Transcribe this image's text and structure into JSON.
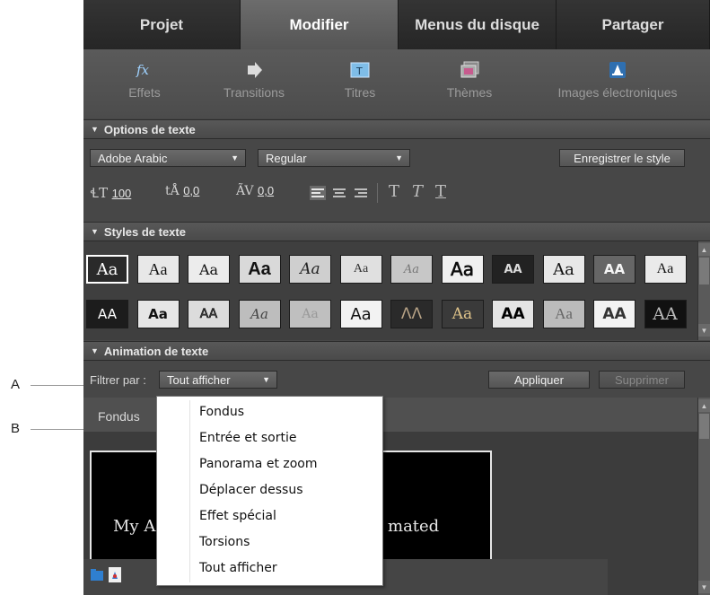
{
  "callouts": {
    "a": "A",
    "b": "B"
  },
  "tabs": [
    {
      "label": "Projet",
      "active": false
    },
    {
      "label": "Modifier",
      "active": true
    },
    {
      "label": "Menus du disque",
      "active": false
    },
    {
      "label": "Partager",
      "active": false
    }
  ],
  "toolbar": {
    "items": [
      {
        "label": "Effets",
        "icon": "fx-icon"
      },
      {
        "label": "Transitions",
        "icon": "transitions-icon"
      },
      {
        "label": "Titres",
        "icon": "titles-icon"
      },
      {
        "label": "Thèmes",
        "icon": "themes-icon"
      },
      {
        "label": "Images électroniques",
        "icon": "clip-art-icon"
      }
    ]
  },
  "text_options": {
    "header": "Options de texte",
    "font": "Adobe Arabic",
    "style": "Regular",
    "save_style": "Enregistrer le style",
    "size": "100",
    "leading": "0,0",
    "kerning": "0,0"
  },
  "text_styles": {
    "header": "Styles de texte",
    "row1": [
      "Aa",
      "Aa",
      "Aa",
      "Aa",
      "Aa",
      "Aa",
      "Aa",
      "Aa",
      "AA",
      "Aa",
      "AA",
      "Aa"
    ],
    "row2": [
      "AA",
      "Aa",
      "AA",
      "Aa",
      "Aa",
      "Aa",
      "ΛΛ",
      "Aa",
      "AA",
      "Aa",
      "AA",
      "AA"
    ]
  },
  "text_animation": {
    "header": "Animation de texte",
    "filter_label": "Filtrer par :",
    "filter_value": "Tout afficher",
    "apply": "Appliquer",
    "delete": "Supprimer",
    "category": "Fondus",
    "preview_left": "My A",
    "preview_right": "mated"
  },
  "menu": {
    "items": [
      "Fondus",
      "Entrée et sortie",
      "Panorama et zoom",
      "Déplacer dessus",
      "Effet spécial",
      "Torsions",
      "Tout afficher"
    ]
  }
}
